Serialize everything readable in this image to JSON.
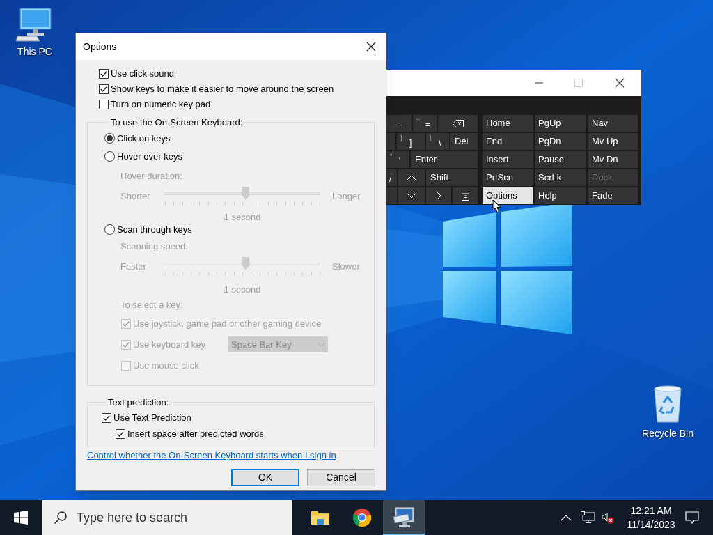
{
  "desktop_icons": [
    {
      "kind": "computer",
      "label": "This PC"
    },
    {
      "kind": "recycle_bin",
      "label": "Recycle Bin"
    }
  ],
  "keyboard_window": {
    "keys": [
      [
        {
          "kind": "char",
          "upper": "_",
          "lower": "-"
        },
        {
          "kind": "char",
          "upper": "+",
          "lower": "="
        },
        {
          "kind": "backspace"
        }
      ],
      [
        {
          "kind": "blank"
        },
        {
          "kind": "char",
          "upper": "}",
          "lower": "]"
        },
        {
          "kind": "char",
          "upper": "|",
          "lower": "\\"
        },
        {
          "kind": "label",
          "label": "Del"
        }
      ],
      [
        {
          "kind": "char",
          "upper": "\"",
          "lower": "'"
        },
        {
          "kind": "label",
          "label": "Enter"
        }
      ],
      [
        {
          "kind": "char",
          "lower": "/"
        },
        {
          "kind": "up"
        },
        {
          "kind": "label",
          "label": "Shift"
        }
      ],
      [
        {
          "kind": "blank"
        },
        {
          "kind": "down"
        },
        {
          "kind": "right"
        },
        {
          "kind": "menu"
        }
      ]
    ],
    "nav_keys": [
      {
        "label": "Home",
        "selected": false,
        "disabled": false
      },
      {
        "label": "PgUp",
        "selected": false,
        "disabled": false
      },
      {
        "label": "Nav",
        "selected": false,
        "disabled": false
      },
      {
        "label": "End",
        "selected": false,
        "disabled": false
      },
      {
        "label": "PgDn",
        "selected": false,
        "disabled": false
      },
      {
        "label": "Mv Up",
        "selected": false,
        "disabled": false
      },
      {
        "label": "Insert",
        "selected": false,
        "disabled": false
      },
      {
        "label": "Pause",
        "selected": false,
        "disabled": false
      },
      {
        "label": "Mv Dn",
        "selected": false,
        "disabled": false
      },
      {
        "label": "PrtScn",
        "selected": false,
        "disabled": false
      },
      {
        "label": "ScrLk",
        "selected": false,
        "disabled": false
      },
      {
        "label": "Dock",
        "selected": false,
        "disabled": true
      },
      {
        "label": "Options",
        "selected": true,
        "disabled": false
      },
      {
        "label": "Help",
        "selected": false,
        "disabled": false
      },
      {
        "label": "Fade",
        "selected": false,
        "disabled": false
      }
    ]
  },
  "dialog": {
    "title": "Options",
    "options": [
      {
        "label": "Use click sound",
        "checked": true
      },
      {
        "label": "Show keys to make it easier to move around the screen",
        "checked": true
      },
      {
        "label": "Turn on numeric key pad",
        "checked": false
      }
    ],
    "input_group": {
      "title": "To use the On-Screen Keyboard:",
      "modes": [
        {
          "label": "Click on keys",
          "selected": true
        },
        {
          "label": "Hover over keys",
          "selected": false,
          "setting": {
            "caption": "Hover duration:",
            "disabled": true,
            "left": "Shorter",
            "right": "Longer",
            "level": 0.52,
            "reading": "1 second"
          }
        },
        {
          "label": "Scan through keys",
          "selected": false,
          "setting": {
            "caption": "Scanning speed:",
            "disabled": true,
            "left": "Faster",
            "right": "Slower",
            "level": 0.52,
            "reading": "1 second"
          }
        }
      ],
      "select_key": {
        "caption": "To select a key:",
        "disabled": true,
        "options": [
          {
            "label": "Use joystick, game pad or other gaming device",
            "checked": true
          },
          {
            "label": "Use keyboard key",
            "checked": true,
            "dropdown": "Space Bar Key"
          },
          {
            "label": "Use mouse click",
            "checked": false
          }
        ]
      }
    },
    "prediction_group": {
      "title": "Text prediction:",
      "options": [
        {
          "label": "Use Text Prediction",
          "checked": true,
          "children": [
            {
              "label": "Insert space after predicted words",
              "checked": true
            }
          ]
        }
      ]
    },
    "link": "Control whether the On-Screen Keyboard starts when I sign in",
    "buttons": [
      {
        "label": "OK",
        "default": true
      },
      {
        "label": "Cancel",
        "default": false
      }
    ]
  },
  "taskbar": {
    "search": {
      "placeholder": "Type here to search"
    },
    "apps": [
      {
        "kind": "file_explorer",
        "active": false
      },
      {
        "kind": "browser",
        "active": false
      },
      {
        "kind": "on_screen_keyboard",
        "active": true
      }
    ],
    "time": "12:21 AM",
    "date": "11/14/2023"
  }
}
